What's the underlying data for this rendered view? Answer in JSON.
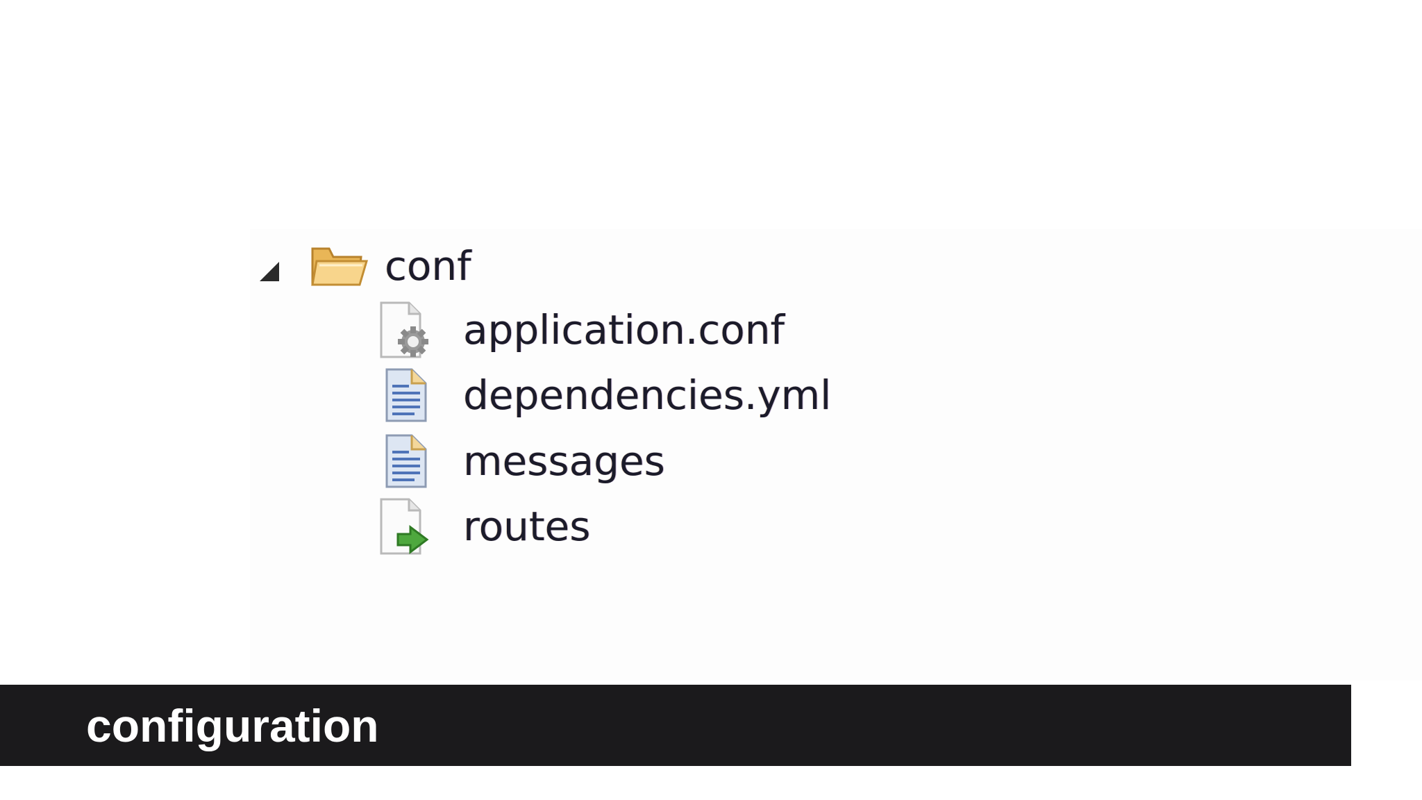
{
  "tree": {
    "folder": {
      "name": "conf",
      "expanded": true,
      "icon": "open-folder-icon",
      "expander_icon": "expanded-triangle-icon"
    },
    "files": [
      {
        "name": "application.conf",
        "icon": "config-file-icon"
      },
      {
        "name": "dependencies.yml",
        "icon": "text-file-icon"
      },
      {
        "name": "messages",
        "icon": "text-file-icon"
      },
      {
        "name": "routes",
        "icon": "routes-file-icon"
      }
    ]
  },
  "caption": {
    "text": "configuration"
  },
  "colors": {
    "caption_background": "#1b1a1c",
    "caption_text": "#ffffff",
    "tree_text": "#1b1b2a",
    "folder": "#f2c46b",
    "routes_arrow": "#4ea83e",
    "text_file_lines": "#4f74b8"
  }
}
